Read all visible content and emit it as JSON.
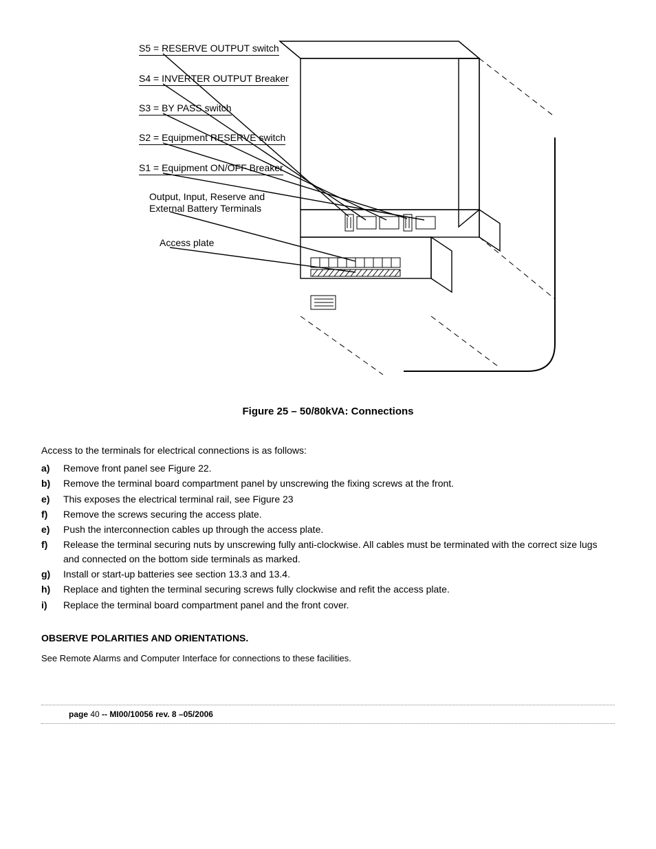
{
  "diagram": {
    "labels": {
      "s5": "S5 = RESERVE OUTPUT switch",
      "s4": "S4 = INVERTER OUTPUT Breaker",
      "s3": "S3 = BY PASS switch",
      "s2": "S2 = Equipment RESERVE switch",
      "s1": "S1 = Equipment ON/OFF Breaker",
      "terminals": "Output, Input, Reserve\nand External Battery Terminals",
      "access": "Access plate"
    }
  },
  "caption": "Figure 25 – 50/80kVA: Connections",
  "intro": "Access to the terminals for electrical connections is as follows:",
  "steps": [
    {
      "letter": "a)",
      "text": "Remove front panel see Figure 22."
    },
    {
      "letter": "b)",
      "text": "Remove the terminal board compartment panel by unscrewing the fixing screws at the front."
    },
    {
      "letter": "e)",
      "text": "This exposes the electrical terminal rail, see Figure 23"
    },
    {
      "letter": "f)",
      "text": "Remove the screws securing the access plate."
    },
    {
      "letter": "e)",
      "text": "Push the interconnection cables up through the access plate."
    },
    {
      "letter": "f)",
      "text": "Release the terminal securing nuts by unscrewing fully anti-clockwise. All cables must be terminated with the correct size lugs and connected on the bottom side terminals as marked."
    },
    {
      "letter": "g)",
      "text": "Install or start-up batteries see section 13.3 and 13.4."
    },
    {
      "letter": "h)",
      "text": "Replace and tighten the terminal securing screws fully clockwise and refit the access plate."
    },
    {
      "letter": "i)",
      "text": "Replace the terminal board compartment panel and the front cover."
    }
  ],
  "observe_title": "OBSERVE POLARITIES AND ORIENTATIONS",
  "observe_text": "See Remote Alarms and Computer Interface for connections to these facilities.",
  "footer": {
    "page_word": "page",
    "page_num": "40",
    "sep": " -- ",
    "doc": "MI00/10056 rev. 8 –05/2006"
  }
}
